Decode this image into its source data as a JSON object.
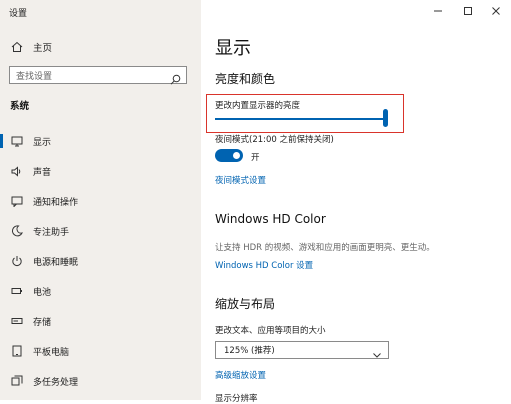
{
  "window": {
    "title": "设置"
  },
  "sidebar": {
    "home_label": "主页",
    "search_placeholder": "查找设置",
    "section_label": "系统",
    "items": [
      {
        "label": "显示",
        "icon": "monitor-icon",
        "active": true
      },
      {
        "label": "声音",
        "icon": "speaker-icon"
      },
      {
        "label": "通知和操作",
        "icon": "notification-icon"
      },
      {
        "label": "专注助手",
        "icon": "moon-icon"
      },
      {
        "label": "电源和睡眠",
        "icon": "power-icon"
      },
      {
        "label": "电池",
        "icon": "battery-icon"
      },
      {
        "label": "存储",
        "icon": "storage-icon"
      },
      {
        "label": "平板电脑",
        "icon": "tablet-icon"
      },
      {
        "label": "多任务处理",
        "icon": "multitask-icon"
      }
    ]
  },
  "main": {
    "title": "显示",
    "brightness_section": "亮度和颜色",
    "brightness_label": "更改内置显示器的亮度",
    "brightness_value": 1.0,
    "night_light_label": "夜间模式(21:00 之前保持关闭)",
    "night_light_state": "开",
    "night_light_settings_link": "夜间模式设置",
    "hdr_title": "Windows HD Color",
    "hdr_desc": "让支持 HDR 的视频、游戏和应用的画面更明亮、更生动。",
    "hdr_link": "Windows HD Color 设置",
    "scale_title": "缩放与布局",
    "scale_label": "更改文本、应用等项目的大小",
    "scale_value": "125% (推荐)",
    "advanced_scale_link": "高级缩放设置",
    "resolution_label": "显示分辨率"
  },
  "colors": {
    "accent": "#0063b1",
    "highlight": "#d9342b"
  }
}
